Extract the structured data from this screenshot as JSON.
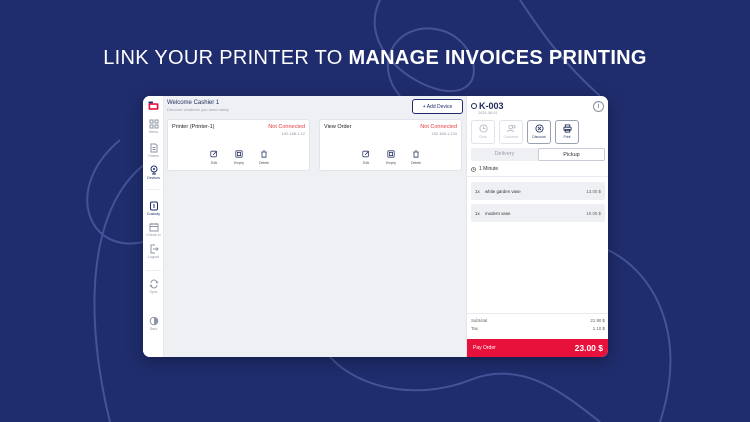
{
  "headline": {
    "normal": "LINK YOUR PRINTER TO ",
    "bold": "MANAGE INVOICES PRINTING"
  },
  "colors": {
    "background": "#1f2d6e",
    "accent": "#1f2d6e",
    "pay_button": "#e8113b",
    "status_error": "#e63b3b"
  },
  "sidebar": {
    "items": [
      {
        "label": "Menu",
        "icon": "grid-icon"
      },
      {
        "label": "Orders",
        "icon": "document-icon"
      },
      {
        "label": "Devices",
        "icon": "printer-device-icon"
      },
      {
        "label": "Custody",
        "icon": "wallet-icon"
      },
      {
        "label": "Check-In",
        "icon": "calendar-icon"
      },
      {
        "label": "Logout",
        "icon": "logout-icon"
      },
      {
        "label": "Sync",
        "icon": "sync-icon"
      },
      {
        "label": "Dark",
        "icon": "contrast-icon"
      }
    ]
  },
  "main": {
    "welcome": "Welcome Cashier 1",
    "subtitle": "Discover whatever you need easily",
    "add_device_label": "+ Add Device",
    "devices": [
      {
        "name": "Printer (Printer-1)",
        "status": "Not Connected",
        "ip": "192.168.1.12",
        "actions": [
          "Edit",
          "Empty",
          "Delete"
        ]
      },
      {
        "name": "View Order",
        "status": "Not Connected",
        "ip": "192.168.1.134",
        "actions": [
          "Edit",
          "Empty",
          "Delete"
        ]
      }
    ]
  },
  "order": {
    "id": "K-003",
    "date": "2024-08-01",
    "info_icon": "i",
    "actions": [
      "Chair",
      "Customer",
      "Discount",
      "Print"
    ],
    "modes": [
      "Delivery",
      "Pickup"
    ],
    "selected_mode": "Pickup",
    "timer": "1 Minute",
    "items": [
      {
        "qty": "1x",
        "name": "white garden vase",
        "price": "13.00 $"
      },
      {
        "qty": "1x",
        "name": "modern vase",
        "price": "10.00 $"
      }
    ],
    "subtotal_label": "Subtotal",
    "subtotal_value": "21.90 $",
    "tax_label": "Tax",
    "tax_value": "1.10 $",
    "pay_label": "Pay Order",
    "pay_total": "23.00 $"
  }
}
